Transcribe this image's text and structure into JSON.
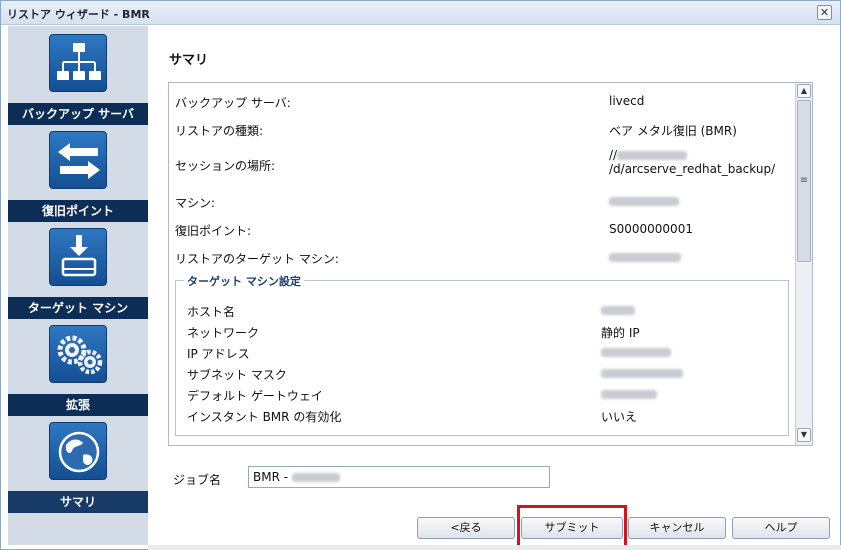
{
  "window": {
    "title": "リストア ウィザード - BMR",
    "close_glyph": "✕"
  },
  "sidebar": {
    "steps": [
      {
        "label": "バックアップ サーバ",
        "icon": "server-network-icon"
      },
      {
        "label": "復旧ポイント",
        "icon": "arrows-exchange-icon"
      },
      {
        "label": "ターゲット マシン",
        "icon": "download-drive-icon"
      },
      {
        "label": "拡張",
        "icon": "gears-icon"
      },
      {
        "label": "サマリ",
        "icon": "globe-icon",
        "active": true
      }
    ]
  },
  "main": {
    "title": "サマリ",
    "summary": [
      {
        "label": "バックアップ サーバ:",
        "value": "livecd"
      },
      {
        "label": "リストアの種類:",
        "value": "ベア メタル復旧 (BMR)"
      },
      {
        "label": "セッションの場所:",
        "value_prefix": "//",
        "value_line2": "/d/arcserve_redhat_backup/"
      },
      {
        "label": "マシン:",
        "value": ""
      },
      {
        "label": "復旧ポイント:",
        "value": "S0000000001"
      },
      {
        "label": "リストアのターゲット マシン:",
        "value": ""
      }
    ],
    "target_settings": {
      "legend": "ターゲット マシン設定",
      "rows": [
        {
          "label": "ホスト名",
          "value": ""
        },
        {
          "label": "ネットワーク",
          "value": "静的 IP"
        },
        {
          "label": "IP アドレス",
          "value": ""
        },
        {
          "label": "サブネット マスク",
          "value": ""
        },
        {
          "label": "デフォルト ゲートウェイ",
          "value": ""
        },
        {
          "label": "インスタント BMR の有効化",
          "value": "いいえ"
        }
      ]
    }
  },
  "job": {
    "label": "ジョブ名",
    "value_prefix": "BMR - "
  },
  "buttons": {
    "back": "<戻る",
    "submit": "サブミット",
    "cancel": "キャンセル",
    "help": "ヘルプ"
  },
  "colors": {
    "highlight": "#d4141c",
    "sidebar_label_bg": "#0c2d55",
    "icon_blue": "#1d63ad"
  }
}
